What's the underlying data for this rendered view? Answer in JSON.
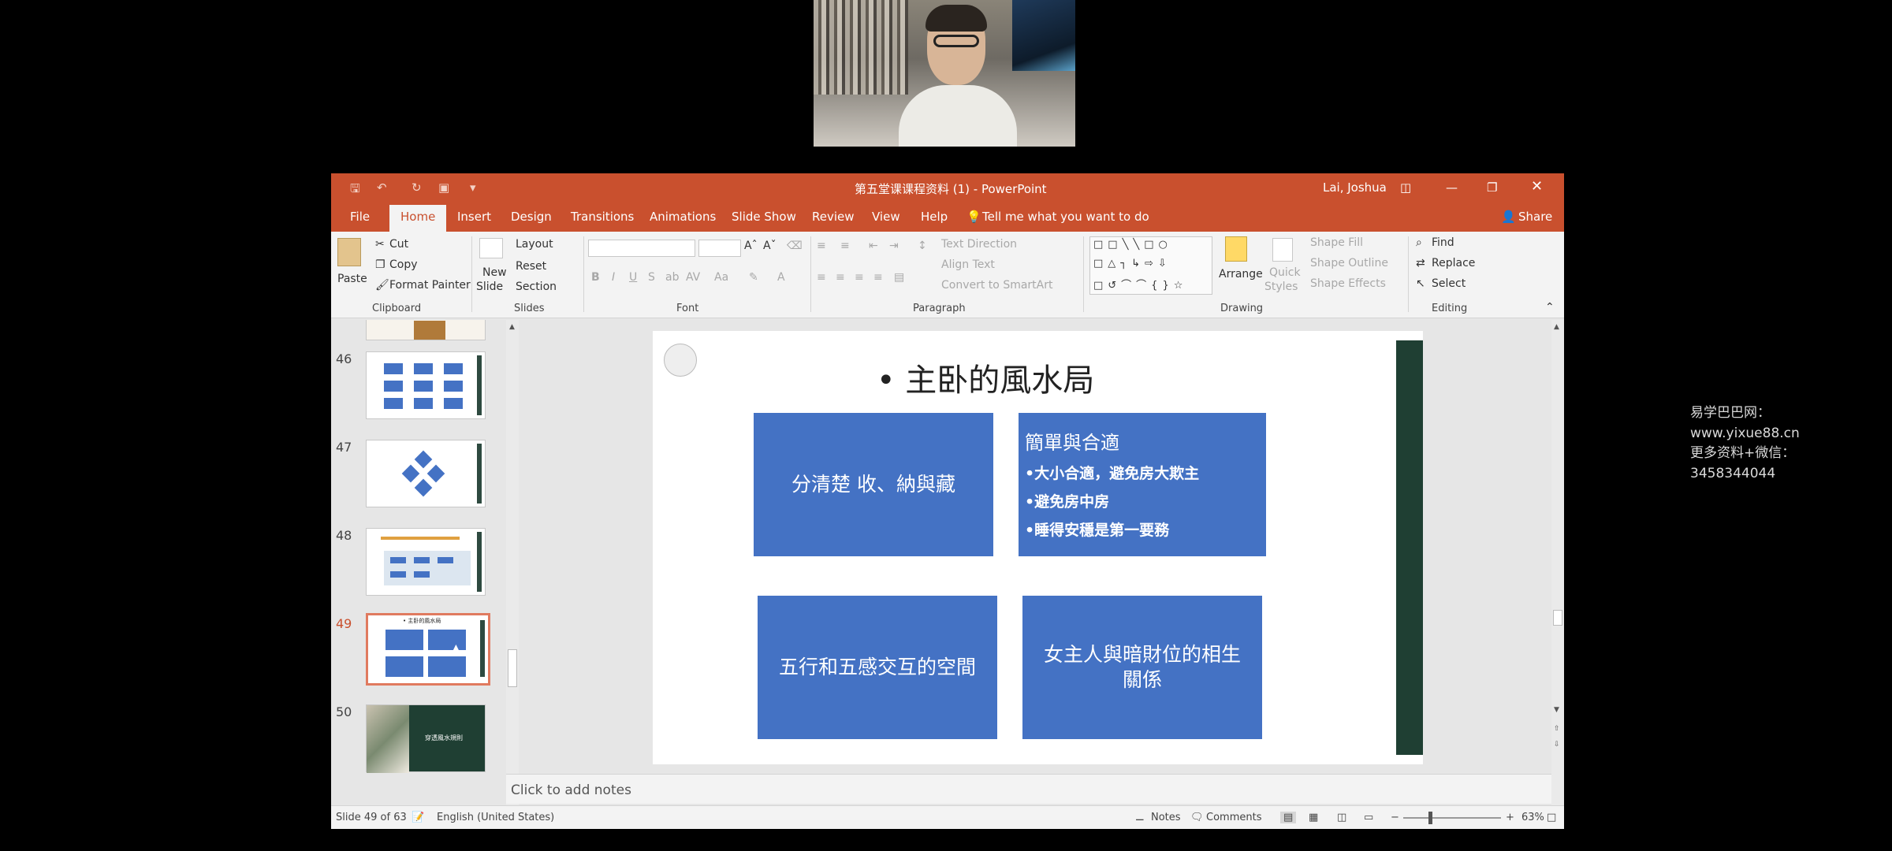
{
  "window": {
    "title": "第五堂课课程资料 (1) - PowerPoint",
    "user": "Lai, Joshua"
  },
  "tabs": [
    "File",
    "Home",
    "Insert",
    "Design",
    "Transitions",
    "Animations",
    "Slide Show",
    "Review",
    "View",
    "Help"
  ],
  "tell_me": "Tell me what you want to do",
  "share": "Share",
  "ribbon": {
    "clipboard": {
      "paste": "Paste",
      "cut": "Cut",
      "copy": "Copy",
      "format_painter": "Format Painter",
      "label": "Clipboard"
    },
    "slides": {
      "new_slide_1": "New",
      "new_slide_2": "Slide",
      "layout": "Layout",
      "reset": "Reset",
      "section": "Section",
      "label": "Slides"
    },
    "font": {
      "label": "Font"
    },
    "paragraph": {
      "text_direction": "Text Direction",
      "align_text": "Align Text",
      "convert_smartart": "Convert to SmartArt",
      "label": "Paragraph"
    },
    "drawing": {
      "arrange": "Arrange",
      "quick_styles_1": "Quick",
      "quick_styles_2": "Styles",
      "shape_fill": "Shape Fill",
      "shape_outline": "Shape Outline",
      "shape_effects": "Shape Effects",
      "label": "Drawing"
    },
    "editing": {
      "find": "Find",
      "replace": "Replace",
      "select": "Select",
      "label": "Editing"
    }
  },
  "thumbnails": [
    {
      "num": "46"
    },
    {
      "num": "47"
    },
    {
      "num": "48"
    },
    {
      "num": "49",
      "title": "• 主卧的風水局"
    },
    {
      "num": "50",
      "title": "穿透風水規則"
    }
  ],
  "slide": {
    "title": "• 主卧的風水局",
    "box1": "分清楚 收、納與藏",
    "box2_heading": "簡單與合適",
    "box2_bullets": [
      "•大小合適，避免房大欺主",
      "•避免房中房",
      "•睡得安穩是第一要務"
    ],
    "box3": "五行和五感交互的空間",
    "box4": "女主人與暗財位的相生關係"
  },
  "notes_placeholder": "Click to add notes",
  "status": {
    "slide_of": "Slide 49 of 63",
    "language": "English (United States)",
    "notes": "Notes",
    "comments": "Comments",
    "zoom": "63%"
  },
  "watermark": {
    "line1": "易学巴巴网：www.yixue88.cn",
    "line2": "更多资料+微信：3458344044"
  },
  "colors": {
    "accent": "#c9502e",
    "slide_box": "#4472c4",
    "dark_bar": "#1f3f33"
  }
}
